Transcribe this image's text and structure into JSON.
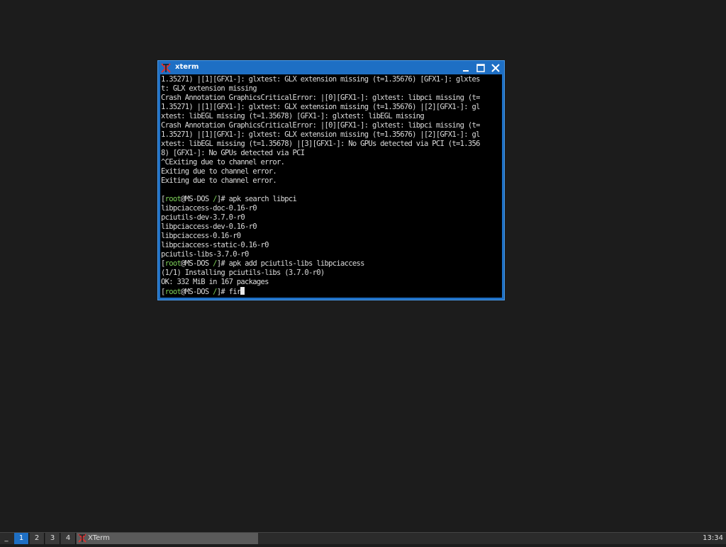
{
  "window": {
    "title": "xterm"
  },
  "terminal": {
    "lines": [
      {
        "parts": [
          {
            "text": "1.35271) |[1][GFX1-]: glxtest: GLX extension missing (t=1.35676) [GFX1-]: glxtes"
          }
        ]
      },
      {
        "parts": [
          {
            "text": "t: GLX extension missing"
          }
        ]
      },
      {
        "parts": [
          {
            "text": "Crash Annotation GraphicsCriticalError: |[0][GFX1-]: glxtest: libpci missing (t="
          }
        ]
      },
      {
        "parts": [
          {
            "text": "1.35271) |[1][GFX1-]: glxtest: GLX extension missing (t=1.35676) |[2][GFX1-]: gl"
          }
        ]
      },
      {
        "parts": [
          {
            "text": "xtest: libEGL missing (t=1.35678) [GFX1-]: glxtest: libEGL missing"
          }
        ]
      },
      {
        "parts": [
          {
            "text": "Crash Annotation GraphicsCriticalError: |[0][GFX1-]: glxtest: libpci missing (t="
          }
        ]
      },
      {
        "parts": [
          {
            "text": "1.35271) |[1][GFX1-]: glxtest: GLX extension missing (t=1.35676) |[2][GFX1-]: gl"
          }
        ]
      },
      {
        "parts": [
          {
            "text": "xtest: libEGL missing (t=1.35678) |[3][GFX1-]: No GPUs detected via PCI (t=1.356"
          }
        ]
      },
      {
        "parts": [
          {
            "text": "8) [GFX1-]: No GPUs detected via PCI"
          }
        ]
      },
      {
        "parts": [
          {
            "text": "^CExiting due to channel error."
          }
        ]
      },
      {
        "parts": [
          {
            "text": "Exiting due to channel error."
          }
        ]
      },
      {
        "parts": [
          {
            "text": "Exiting due to channel error."
          }
        ]
      },
      {
        "parts": [
          {
            "text": ""
          }
        ]
      },
      {
        "parts": [
          {
            "text": "["
          },
          {
            "text": "root",
            "color": "green"
          },
          {
            "text": "@MS-DOS "
          },
          {
            "text": "/",
            "color": "green"
          },
          {
            "text": "]# apk search libpci"
          }
        ]
      },
      {
        "parts": [
          {
            "text": "libpciaccess-doc-0.16-r0"
          }
        ]
      },
      {
        "parts": [
          {
            "text": "pciutils-dev-3.7.0-r0"
          }
        ]
      },
      {
        "parts": [
          {
            "text": "libpciaccess-dev-0.16-r0"
          }
        ]
      },
      {
        "parts": [
          {
            "text": "libpciaccess-0.16-r0"
          }
        ]
      },
      {
        "parts": [
          {
            "text": "libpciaccess-static-0.16-r0"
          }
        ]
      },
      {
        "parts": [
          {
            "text": "pciutils-libs-3.7.0-r0"
          }
        ]
      },
      {
        "parts": [
          {
            "text": "["
          },
          {
            "text": "root",
            "color": "green"
          },
          {
            "text": "@MS-DOS "
          },
          {
            "text": "/",
            "color": "green"
          },
          {
            "text": "]# apk add pciutils-libs libpciaccess"
          }
        ]
      },
      {
        "parts": [
          {
            "text": "(1/1) Installing pciutils-libs (3.7.0-r0)"
          }
        ]
      },
      {
        "parts": [
          {
            "text": "OK: 332 MiB in 167 packages"
          }
        ]
      },
      {
        "parts": [
          {
            "text": "["
          },
          {
            "text": "root",
            "color": "green"
          },
          {
            "text": "@MS-DOS "
          },
          {
            "text": "/",
            "color": "green"
          },
          {
            "text": "]# fir"
          }
        ],
        "cursor": true
      }
    ]
  },
  "taskbar": {
    "menu_label": "_",
    "workspaces": [
      "1",
      "2",
      "3",
      "4"
    ],
    "active_workspace": "1",
    "task_label": "XTerm",
    "clock": "13:34"
  },
  "colors": {
    "titlebar": "#1e6fc4",
    "prompt_green": "#7fd35a",
    "terminal_bg": "#000000",
    "desktop_bg": "#1c1c1c"
  },
  "icons": {
    "window_icon": "xterm-x-icon",
    "minimize": "minimize-icon",
    "maximize": "maximize-icon",
    "close": "close-icon"
  }
}
